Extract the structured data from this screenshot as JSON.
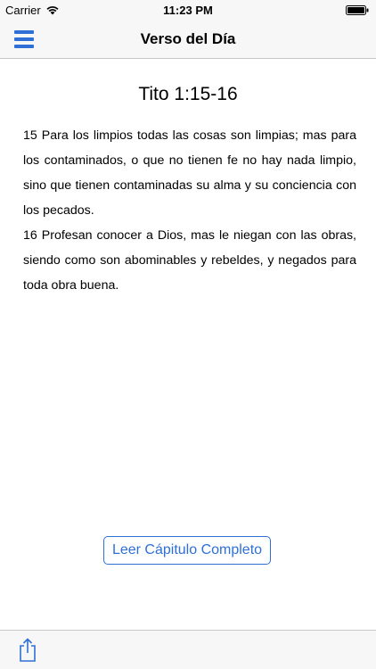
{
  "status_bar": {
    "carrier": "Carrier",
    "time": "11:23 PM"
  },
  "nav": {
    "title": "Verso del Día",
    "menu_icon": "hamburger-menu-icon"
  },
  "verse": {
    "reference": "Tito 1:15-16",
    "paragraphs": [
      "15 Para los limpios todas las cosas son limpias; mas para los contaminados, o que no tienen fe no hay nada limpio, sino que tienen contaminadas su alma y su conciencia con los pecados.",
      "16 Profesan conocer a Dios, mas le niegan con las obras, siendo como son abominables y rebeldes, y negados para toda obra buena."
    ]
  },
  "actions": {
    "read_chapter_label": "Leer Cápitulo Completo"
  },
  "toolbar": {
    "share_icon": "share-icon"
  },
  "colors": {
    "accent": "#2f6fd6",
    "bar_background": "#f7f7f7"
  }
}
